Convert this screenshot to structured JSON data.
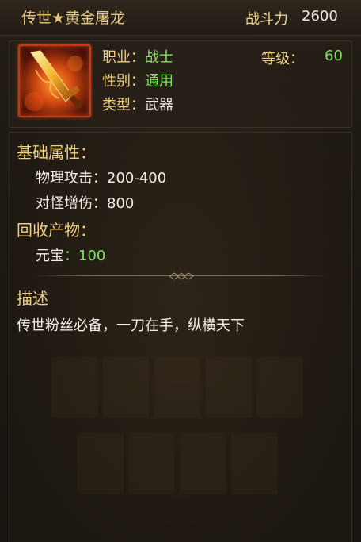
{
  "header": {
    "title": "传世★黄金屠龙",
    "power_label": "战斗力",
    "power_value": "2600"
  },
  "item": {
    "icon": "golden-dragon-slayer-blade-icon",
    "class_label": "职业：",
    "class_value": "战士",
    "gender_label": "性别：",
    "gender_value": "通用",
    "type_label": "类型：",
    "type_value": "武器",
    "level_label": "等级：",
    "level_value": "60"
  },
  "base_attributes": {
    "title": "基础属性：",
    "physical_attack": "物理攻击：200-400",
    "monster_damage": "对怪增伤：800"
  },
  "recycle": {
    "title": "回收产物：",
    "yuanbao_label": "元宝",
    "yuanbao_value": "：100"
  },
  "description": {
    "title": "描述",
    "text": "传世粉丝必备，一刀在手，纵横天下"
  },
  "colors": {
    "label_gold": "#efcf80",
    "value_green": "#7ee35c",
    "text_white": "#f2eee6",
    "icon_border": "#c53a1a"
  }
}
